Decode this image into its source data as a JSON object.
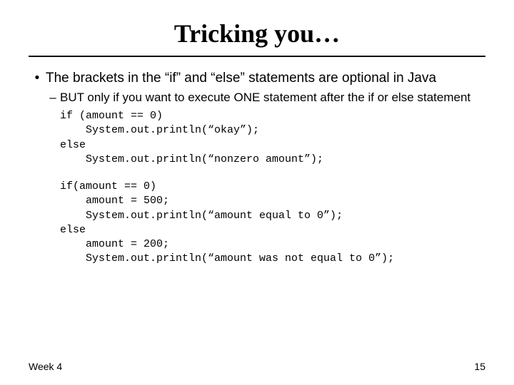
{
  "slide": {
    "title": "Tricking you…",
    "bullet1": "The brackets in the “if” and “else” statements are optional in Java",
    "subbullet1": "BUT only if you want to execute ONE statement after the if or else statement",
    "code1": "if (amount == 0)\n    System.out.println(“okay”);\nelse\n    System.out.println(“nonzero amount”);",
    "code2": "if(amount == 0)\n    amount = 500;\n    System.out.println(“amount equal to 0”);\nelse\n    amount = 200;\n    System.out.println(“amount was not equal to 0”);",
    "footer_left": "Week 4",
    "footer_right": "15"
  }
}
